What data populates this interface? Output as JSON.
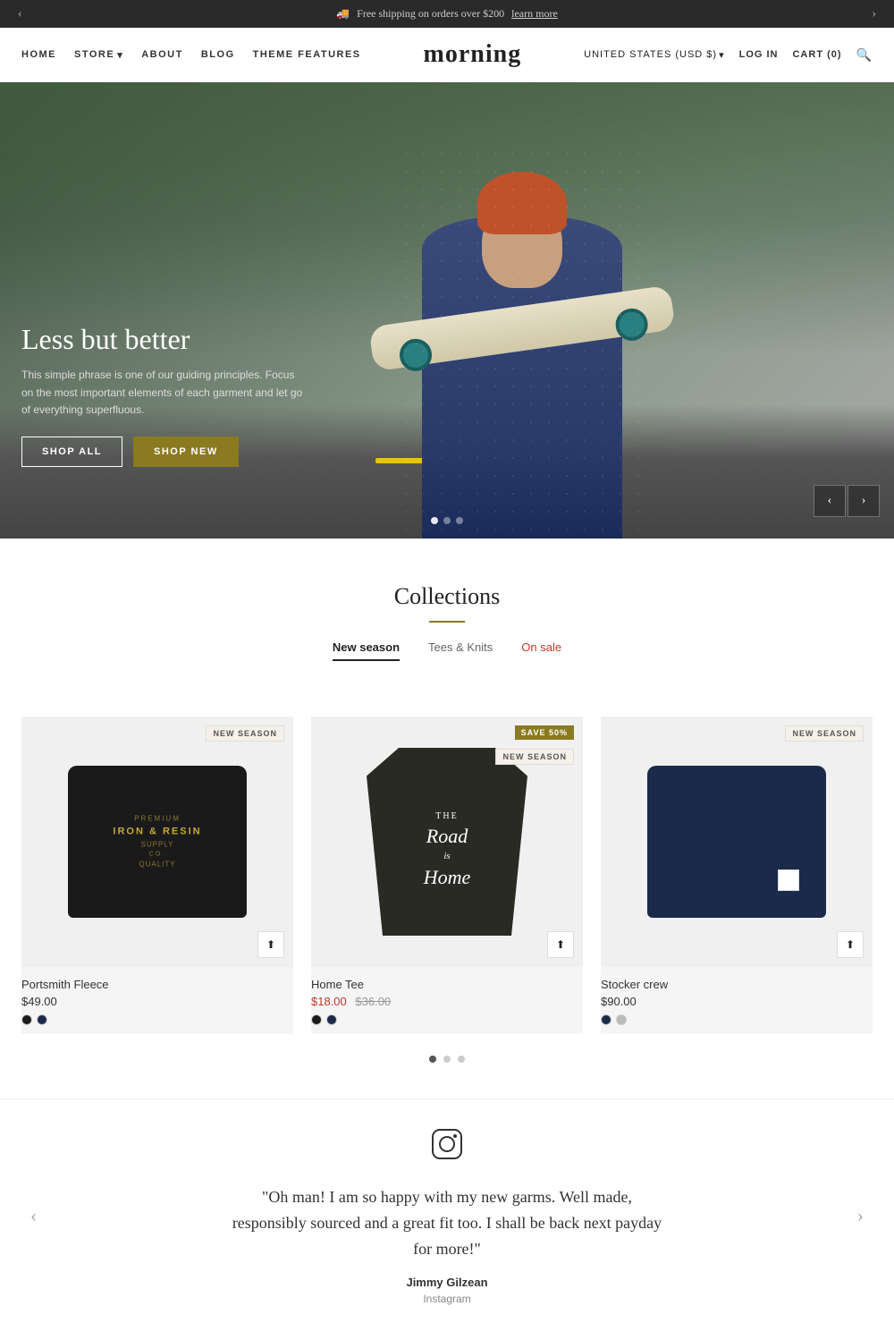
{
  "announcement": {
    "text": "Free shipping on orders over $200",
    "link_text": "learn more",
    "arrow_left": "‹",
    "arrow_right": "›"
  },
  "nav": {
    "links": [
      {
        "id": "home",
        "label": "HOME"
      },
      {
        "id": "store",
        "label": "STORE",
        "has_dropdown": true
      },
      {
        "id": "about",
        "label": "ABOUT"
      },
      {
        "id": "blog",
        "label": "BLOG"
      },
      {
        "id": "theme",
        "label": "THEME FEATURES"
      }
    ],
    "brand": "morning",
    "right": {
      "country": "UNITED STATES (USD $)",
      "login": "LOG IN",
      "cart": "CART (0)"
    }
  },
  "hero": {
    "title": "Less but better",
    "description": "This simple phrase is one of our guiding principles. Focus on the most important elements of each garment and let go of everything superfluous.",
    "btn_shop_all": "SHOP ALL",
    "btn_shop_new": "SHOP NEW",
    "dots": [
      true,
      false,
      false
    ],
    "arrow_left": "‹",
    "arrow_right": "›"
  },
  "collections": {
    "title": "Collections",
    "tabs": [
      {
        "id": "new-season",
        "label": "New season",
        "active": true,
        "sale": false
      },
      {
        "id": "tees-knits",
        "label": "Tees & Knits",
        "active": false,
        "sale": false
      },
      {
        "id": "on-sale",
        "label": "On sale",
        "active": false,
        "sale": true
      }
    ],
    "products": [
      {
        "id": "portsmith",
        "name": "Portsmith Fleece",
        "price": "$49.00",
        "sale_price": null,
        "original_price": null,
        "badge": "NEW SEASON",
        "badge_type": "new-season",
        "swatches": [
          "#1a1a1a",
          "#1a2a4a"
        ],
        "type": "sweater-black"
      },
      {
        "id": "home-tee",
        "name": "Home Tee",
        "price": "$18.00",
        "sale_price": "$18.00",
        "original_price": "$36.00",
        "badge_top": "SAVE 50%",
        "badge_top_type": "save",
        "badge_sub": "NEW SEASON",
        "badge_sub_type": "new-season",
        "swatches": [
          "#1a1a1a",
          "#1a2a4a"
        ],
        "type": "tee"
      },
      {
        "id": "stocker-crew",
        "name": "Stocker crew",
        "price": "$90.00",
        "sale_price": null,
        "original_price": null,
        "badge": "NEW SEASON",
        "badge_type": "new-season",
        "swatches": [
          "#1a2a4a",
          "#bbb"
        ],
        "type": "sweater-navy"
      }
    ],
    "pagination_dots": [
      true,
      false,
      false
    ]
  },
  "instagram": {
    "quote": "\"Oh man! I am so happy with my new garms. Well made, responsibly sourced and a great fit too. I shall be back next payday for more!\"",
    "author": "Jimmy Gilzean",
    "handle": "Instagram",
    "arrow_prev": "‹",
    "arrow_next": "›"
  }
}
